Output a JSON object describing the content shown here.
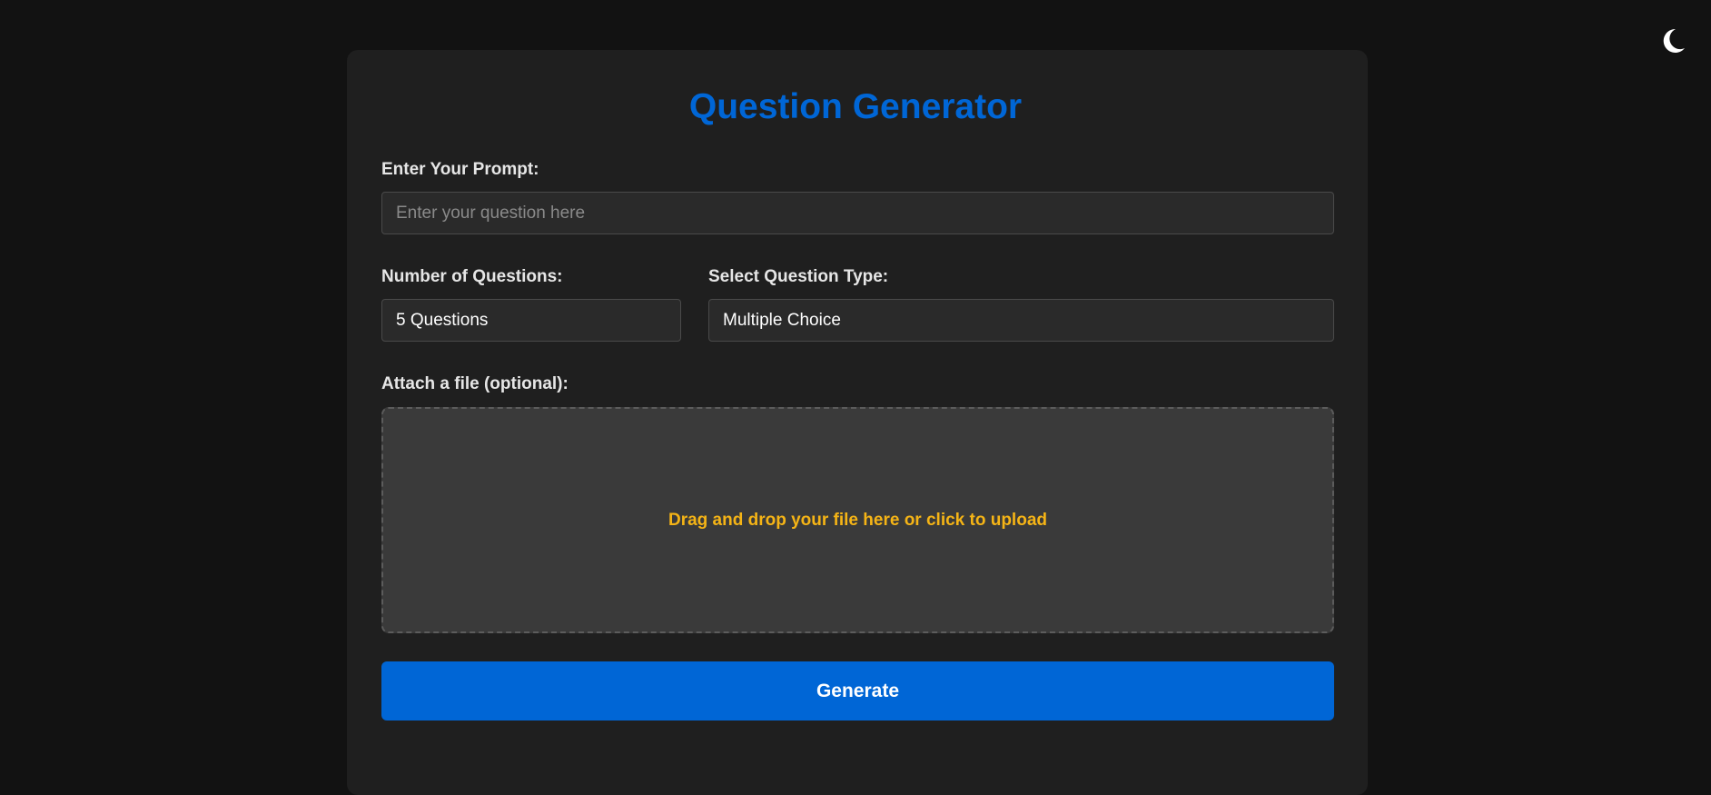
{
  "theme_toggle": {
    "icon": "moon-icon"
  },
  "form": {
    "title": "Question Generator",
    "prompt": {
      "label": "Enter Your Prompt:",
      "placeholder": "Enter your question here",
      "value": ""
    },
    "num_questions": {
      "label": "Number of Questions:",
      "selected": "5 Questions"
    },
    "question_type": {
      "label": "Select Question Type:",
      "selected": "Multiple Choice"
    },
    "file": {
      "label": "Attach a file (optional):",
      "dropzone_text": "Drag and drop your file here or click to upload"
    },
    "generate_label": "Generate"
  },
  "colors": {
    "accent": "#0066d6",
    "dropzone_text": "#f5b416",
    "page_bg": "#121212",
    "card_bg": "#1f1f1f"
  }
}
